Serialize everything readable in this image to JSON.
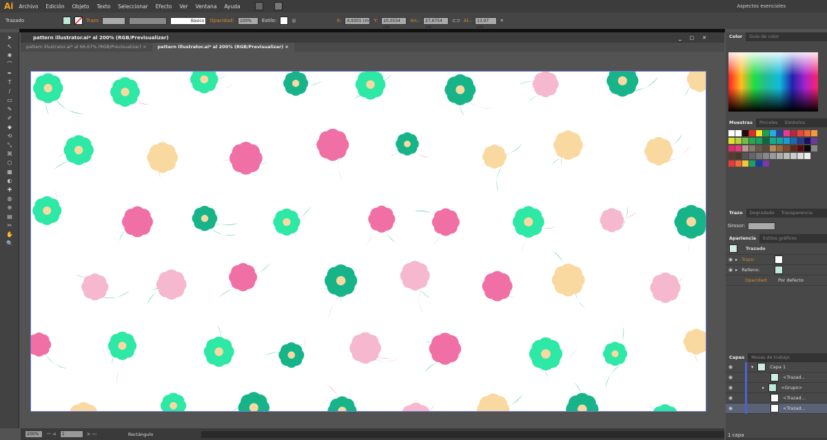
{
  "app": {
    "logo": "Ai",
    "menu": [
      "Archivo",
      "Edición",
      "Objeto",
      "Texto",
      "Seleccionar",
      "Efecto",
      "Ver",
      "Ventana",
      "Ayuda"
    ],
    "workspace": "Aspectos esenciales"
  },
  "control": {
    "selection": "Trazado",
    "stroke_label": "Trazo",
    "brush": "Básico",
    "opacity_label": "Opacidad:",
    "opacity": "100%",
    "style_label": "Estilo:",
    "x_label": "X:",
    "x": "4,9301 cm",
    "y_label": "Y:",
    "y": "20,0554 cm",
    "w_label": "An.:",
    "w": "27,6754 cm",
    "h_label": "Al.:",
    "h": "13,97 cm"
  },
  "document": {
    "title": "pattern illustrator.ai* al 200% (RGB/Previsualizar)",
    "tabs": [
      {
        "label": "pattern illustrator.ai* al 66,67% (RGB/Previsualizar)"
      },
      {
        "label": "pattern illustrator.ai* al 200% (RGB/Previsualizar)"
      }
    ],
    "close": "×"
  },
  "pattern_colors": [
    "#f06fa5",
    "#f5b8cf",
    "#2ee8a5",
    "#17b48a",
    "#f9d9a0"
  ],
  "status": {
    "zoom": "200%",
    "page": "1",
    "tool": "Rectángulo"
  },
  "panels": {
    "color": {
      "tabs": [
        "Color",
        "Guía de color"
      ]
    },
    "swatches": {
      "tabs": [
        "Muestras",
        "Pinceles",
        "Símbolos"
      ],
      "rows": [
        [
          "#ffffff",
          "#ffffff",
          "#200c08",
          "#e02b2b",
          "#f7e81e",
          "#1aa34a",
          "#19b1e6",
          "#2a3f9a",
          "#e63a96",
          "#b8263a",
          "#e8473a",
          "#ef6b3a",
          "#f39c3a",
          "#f3a43a"
        ],
        [
          "#e2e22a",
          "#b4d23a",
          "#6fbf45",
          "#27a84a",
          "#1aa060",
          "#0c6a3a",
          "#15aa90",
          "#13a6a0",
          "#1a9ad8",
          "#1a6ab8",
          "#273a8e",
          "#1a1060",
          "#6a3a9a",
          "#8a2a90",
          "#a82a7a"
        ],
        [
          "#e02a6a",
          "#e83a7a",
          "#b89a8a",
          "#8a7a6a",
          "#6a5a4a",
          "#5a4a3a",
          "#b88a5a",
          "#9a6a3a",
          "#7a4a2a",
          "#5a2a1a",
          "#5a0a0a",
          "#0a0a0a",
          "#888888",
          "#f3a43a",
          "#6a9ad8"
        ],
        [
          "#5a3a2a",
          "#4a3a2a",
          "#555555",
          "#666666",
          "#777777",
          "#888888",
          "#999999",
          "#aaaaaa",
          "#bbbbbb",
          "#cccccc",
          "#dddddd",
          "#eeeeee"
        ],
        [
          "#e83a3a",
          "#ef6b3a",
          "#f3c83a",
          "#1aa060",
          "#1a3aa8",
          "#7a3aa8"
        ]
      ]
    },
    "stroke": {
      "tabs": [
        "Trazo",
        "Degradado",
        "Transparencia"
      ],
      "weight_label": "Grosor:"
    },
    "appearance": {
      "tabs": [
        "Apariencia",
        "Estilos gráficos"
      ],
      "title": "Trazado",
      "rows": [
        {
          "label": "Trazo:"
        },
        {
          "label": "Relleno:"
        },
        {
          "label": "Opacidad:",
          "value": "Por defecto"
        }
      ]
    },
    "layers": {
      "tabs": [
        "Capas",
        "Mesas de trabajo"
      ],
      "items": [
        "Capa 1",
        "<Trazad...",
        "<Grupo>",
        "<Trazad...",
        "<Trazad..."
      ],
      "count": "1 capa"
    }
  }
}
